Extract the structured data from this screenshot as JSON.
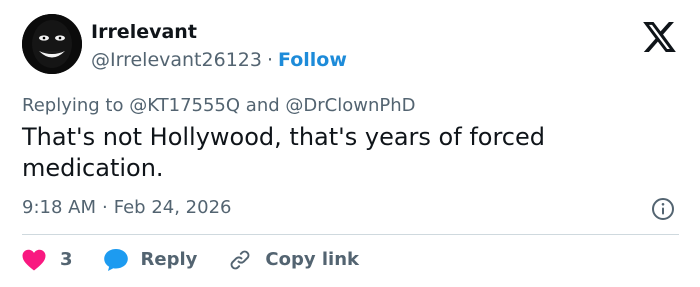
{
  "author": {
    "name": "Irrelevant",
    "handle": "@Irrelevant26123",
    "separator": "·",
    "follow_label": "Follow"
  },
  "reply_context": {
    "prefix": "Replying to",
    "mention_1": "@KT17555Q",
    "conjunction": "and",
    "mention_2": "@DrClownPhD"
  },
  "tweet": {
    "text": "That's not Hollywood, that's years of forced medication."
  },
  "meta": {
    "time": "9:18 AM",
    "separator": "·",
    "date": "Feb 24, 2026"
  },
  "actions": {
    "like_count": "3",
    "reply_label": "Reply",
    "copy_label": "Copy link"
  },
  "colors": {
    "like_heart": "#f91880",
    "reply_bubble": "#1d9bf0",
    "follow": "#1d8bd9",
    "secondary_text": "#536471"
  },
  "icons": {
    "brand": "x-logo-icon",
    "info": "info-icon",
    "like": "heart-icon",
    "reply": "speech-bubble-icon",
    "copy": "link-icon"
  }
}
